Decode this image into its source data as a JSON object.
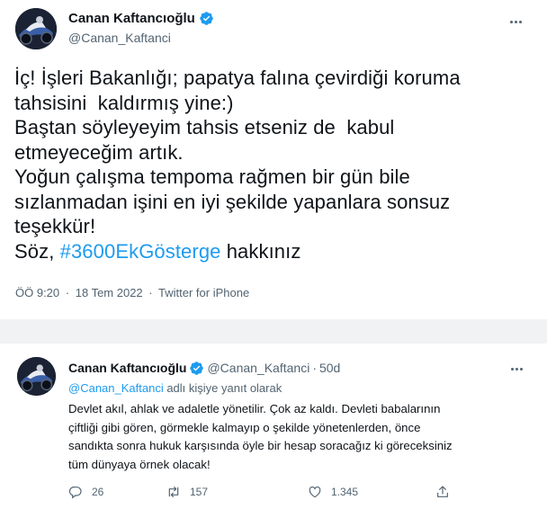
{
  "tweet_main": {
    "author_name": "Canan Kaftancıoğlu",
    "author_handle": "@Canan_Kaftanci",
    "body_lines": [
      "İç! İşleri Bakanlığı; papatya falına çevirdiği koruma",
      "tahsisini  kaldırmış yine:)",
      "Baştan söyleyeyim tahsis etseniz de  kabul",
      "etmeyeceğim artık.",
      "Yoğun çalışma tempoma rağmen bir gün bile",
      "sızlanmadan işini en iyi şekilde yapanlara sonsuz",
      "teşekkür!"
    ],
    "last_line_prefix": "Söz, ",
    "hashtag": "#3600EkGösterge",
    "last_line_suffix": " hakkınız",
    "time": "ÖÖ 9:20",
    "separator": "·",
    "date": "18 Tem 2022",
    "source": "Twitter for iPhone"
  },
  "tweet_reply": {
    "author_name": "Canan Kaftancıoğlu",
    "author_handle": "@Canan_Kaftanci",
    "separator": "·",
    "age": "50d",
    "reply_to_handle": "@Canan_Kaftanci",
    "reply_to_suffix": " adlı kişiye yanıt olarak",
    "body_lines": [
      "Devlet akıl, ahlak ve adaletle yönetilir. Çok az kaldı. Devleti babalarının",
      "çiftliği gibi gören, görmekle kalmayıp o şekilde yönetenlerden, önce",
      "sandıkta sonra hukuk karşısında öyle bir hesap soracağız ki göreceksiniz",
      "tüm dünyaya örnek olacak!"
    ],
    "stats": {
      "replies": "26",
      "retweets": "157",
      "likes": "1.345"
    }
  },
  "colors": {
    "accent": "#1d9bf0",
    "text_primary": "#0f1419",
    "text_secondary": "#536471",
    "gap_band": "#f0f2f4"
  },
  "icons": [
    "verified-badge-icon",
    "more-dots-icon",
    "reply-icon",
    "retweet-icon",
    "like-icon",
    "share-icon"
  ]
}
